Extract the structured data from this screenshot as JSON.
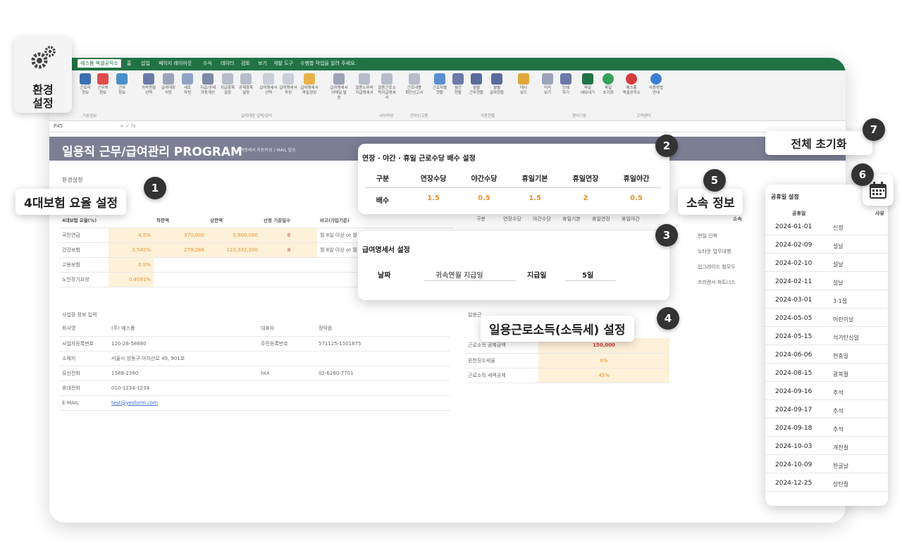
{
  "ribbon": {
    "tabs": [
      "예스폼 엑셀공작소",
      "홈",
      "삽입",
      "페이지 레이아웃",
      "수식",
      "데이터",
      "검토",
      "보기",
      "개발 도구",
      "수행할 작업을 알려 주세요."
    ],
    "buttons": [
      "근로자\n정보",
      "근무처\n정보",
      "근무\n정보",
      "귀속연월\n선택",
      "급여대장\n저장",
      "새로\n작성",
      "지급/공제\n자동계산",
      "지급항목\n설정",
      "공제항목\n설정",
      "급여명세서\n선택",
      "급여명세서\n작성",
      "급여명세서\n파일생성",
      "급여명세서\n이메일 발송",
      "일용노무비\n지급명세서",
      "일용근로소\n득지급명세서",
      "근로내용\n확인신고서",
      "근로자별\n현황",
      "월간\n현황",
      "월별\n근무현황",
      "월별\n급여현황",
      "대시\n보드",
      "미리\n보기",
      "인쇄\n하기",
      "파일\n내보내기",
      "파일\n초기화",
      "예스폼\n엑셀공작소",
      "사용방법\n안내"
    ],
    "groups": [
      "기본정보",
      "급여대장 입력/관리",
      "서식작성",
      "전자신고용",
      "각종현황",
      "편리기능",
      "고객센터"
    ],
    "cell_ref": "P45",
    "formula_icons": "× ✓ fx"
  },
  "banner": {
    "title": "일용직 근무/급여관리 PROGRAM",
    "subtitle": "급여명세서 자동작성 / MAIL 발송"
  },
  "env_section": {
    "label": "환경설정"
  },
  "insurance": {
    "headers": [
      "4대보험 요율(%)",
      "",
      "하한액",
      "상한액",
      "산정 기준일수",
      "비고(가입기준)"
    ],
    "rows": [
      [
        "국민연금",
        "4.5%",
        "370,000",
        "5,900,000",
        "8",
        "월 8일 이상 or 월"
      ],
      [
        "건강보험",
        "3.545%",
        "279,266",
        "110,332,300",
        "8",
        "월 8일 이상 or 월"
      ],
      [
        "고용보험",
        "0.9%",
        "",
        "",
        "",
        ""
      ],
      [
        "노인장기요양",
        "0.4591%",
        "",
        "",
        "",
        ""
      ]
    ]
  },
  "bg_mult_header": [
    "구분",
    "연장수당",
    "야간수당",
    "휴일기본",
    "휴일연장",
    "휴일야간"
  ],
  "bg_affil_header": "소속",
  "bg_affil_rows": [
    "현일 인력",
    "뉴타운 업무대행",
    "업그레이드 힘모두",
    "프리랜서 파트너스"
  ],
  "business": {
    "label": "사업장 정보 입력",
    "rows": [
      [
        "회사명",
        "(주) 예스폼",
        "대표자",
        "정막음"
      ],
      [
        "사업자등록번호",
        "120-28-58680",
        "주민등록번호",
        "571125-1501875"
      ],
      [
        "소재지",
        "서울시 성동구 아차산로 49, 901호",
        "",
        ""
      ],
      [
        "유선전화",
        "1588-2390",
        "FAX",
        "02-6280-7701"
      ],
      [
        "휴대전화",
        "010-1234-1234",
        "",
        ""
      ],
      [
        "E-MAIL",
        "test@yesform.com",
        "",
        ""
      ]
    ]
  },
  "income_tax": {
    "label": "일용근",
    "rows": [
      [
        "근로소득 공제금액",
        "150,000"
      ],
      [
        "원천징수세율",
        "6%"
      ],
      [
        "근로소득 세액공제",
        "45%"
      ]
    ]
  },
  "multiplier_card": {
    "title": "연장 · 야간 · 휴일 근로수당 배수 설정",
    "headers": [
      "구분",
      "연장수당",
      "야간수당",
      "휴일기본",
      "휴일연장",
      "휴일야간"
    ],
    "values": [
      "배수",
      "1.5",
      "0.5",
      "1.5",
      "2",
      "0.5"
    ]
  },
  "payslip_card": {
    "title": "급여명세서 설정",
    "label1": "날짜",
    "value1": "귀속연월 지급일",
    "label2": "지급일",
    "value2": "5일"
  },
  "holidays_card": {
    "title": "공휴일 설정",
    "col1": "공휴일",
    "col2": "사유",
    "rows": [
      [
        "2024-01-01",
        "신정"
      ],
      [
        "2024-02-09",
        "설날"
      ],
      [
        "2024-02-10",
        "설날"
      ],
      [
        "2024-02-11",
        "설날"
      ],
      [
        "2024-03-01",
        "3·1절"
      ],
      [
        "2024-05-05",
        "어린이날"
      ],
      [
        "2024-05-15",
        "석가탄신일"
      ],
      [
        "2024-06-06",
        "현충일"
      ],
      [
        "2024-08-15",
        "광복절"
      ],
      [
        "2024-09-16",
        "추석"
      ],
      [
        "2024-09-17",
        "추석"
      ],
      [
        "2024-09-18",
        "추석"
      ],
      [
        "2024-10-03",
        "개천절"
      ],
      [
        "2024-10-09",
        "한글날"
      ],
      [
        "2024-12-25",
        "성탄절"
      ]
    ]
  },
  "callouts": {
    "env_button": "환경\n설정",
    "insurance": "4대보험 요율 설정",
    "income_tax": "일용근로소득(소득세) 설정",
    "affiliation": "소속 정보",
    "reset": "전체 초기화"
  },
  "badges": [
    "1",
    "2",
    "3",
    "4",
    "5",
    "6",
    "7"
  ],
  "colors": {
    "ribbon_green": "#217346",
    "banner": "#7c7f94",
    "highlight_bg": "#fdf1d9",
    "highlight_text": "#e8912d",
    "badge": "#333333"
  }
}
